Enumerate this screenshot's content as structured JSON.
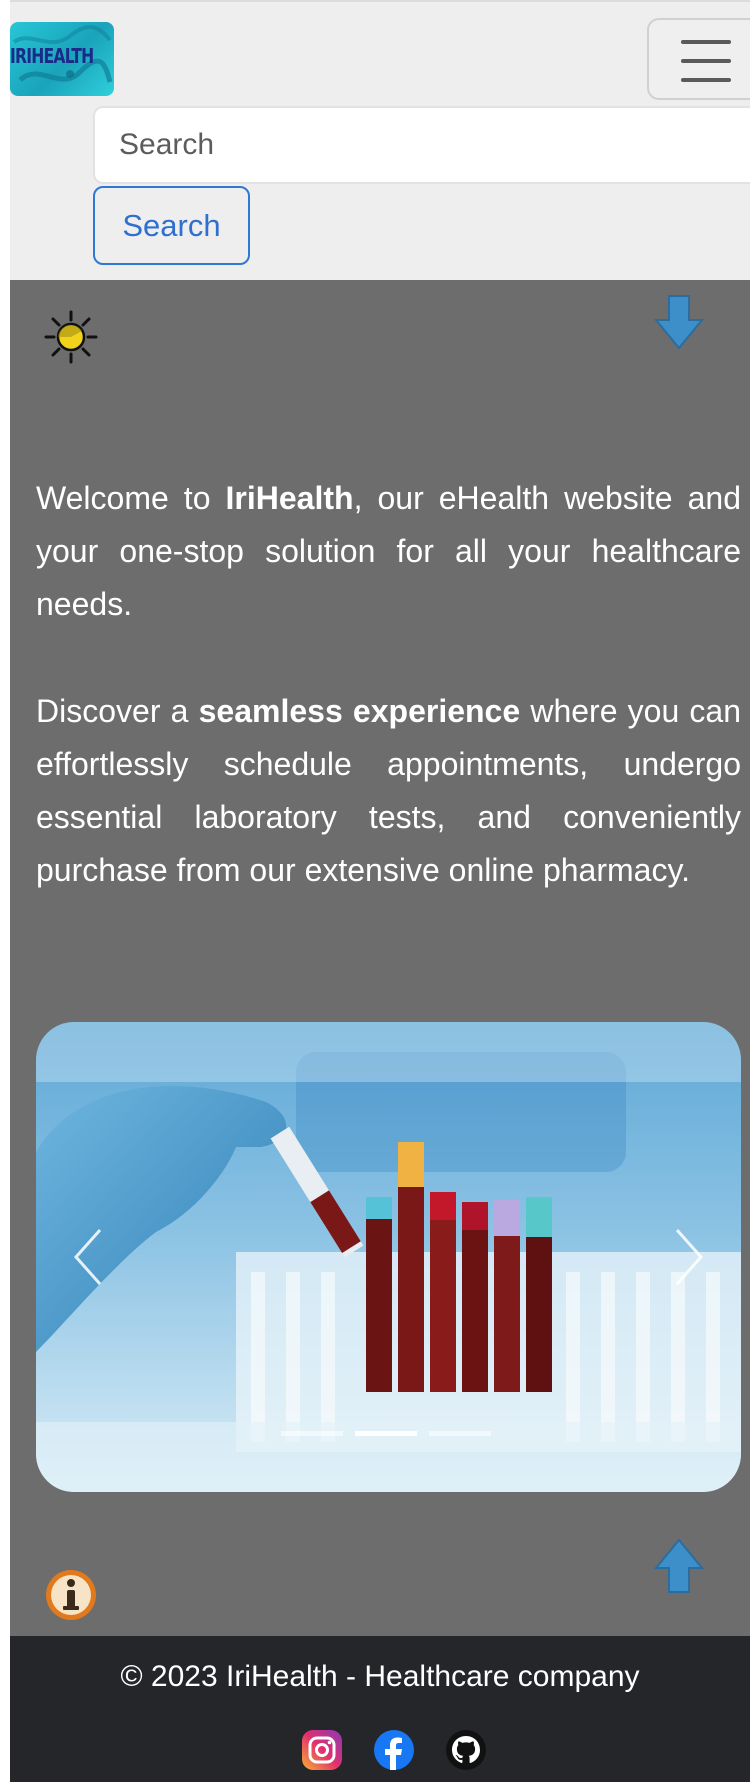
{
  "header": {
    "logo_text": "IRIHEALTH",
    "search": {
      "placeholder": "Search",
      "button_label": "Search"
    }
  },
  "main": {
    "theme_icon": "sun-icon",
    "scroll_down_icon": "arrow-down-icon",
    "intro_1": {
      "pre": "Welcome to ",
      "brand": "IriHealth",
      "post": ", our eHealth website and your one-stop solution for all your healthcare needs."
    },
    "intro_2": {
      "pre": "Discover a ",
      "bold": "seamless experience",
      "post": " where you can effortlessly schedule appointments, undergo essential laboratory tests, and conveniently purchase from our extensive online pharmacy."
    },
    "carousel": {
      "slide_count": 3,
      "active_slide": 2,
      "image_subject": "gloved hand holding blood sample tube over test-tube rack"
    },
    "info_icon": "info-icon",
    "scroll_up_icon": "arrow-up-icon"
  },
  "footer": {
    "copyright": "© 2023 IriHealth - Healthcare company",
    "social": [
      "instagram-icon",
      "facebook-icon",
      "github-icon"
    ]
  },
  "colors": {
    "header_bg": "#eeeeee",
    "main_bg": "#6d6d6d",
    "footer_bg": "#24262a",
    "accent_blue": "#2f6fd0",
    "arrow_blue": "#3d8fc9"
  }
}
